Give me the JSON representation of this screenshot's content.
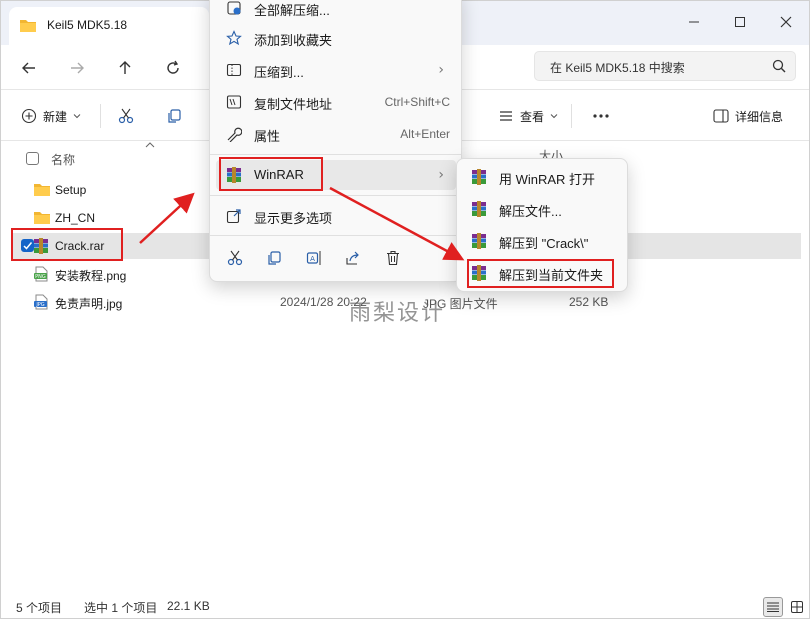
{
  "window": {
    "tab_title": "Keil5 MDK5.18",
    "search_placeholder": "在 Keil5 MDK5.18 中搜索"
  },
  "toolbar": {
    "new_label": "新建",
    "view_label": "查看",
    "details_label": "详细信息"
  },
  "columns": {
    "name": "名称",
    "size": "大小"
  },
  "files": [
    {
      "name": "Setup",
      "type": "folder"
    },
    {
      "name": "ZH_CN",
      "type": "folder"
    },
    {
      "name": "Crack.rar",
      "type": "rar",
      "selected": true
    },
    {
      "name": "安装教程.png",
      "type": "png"
    },
    {
      "name": "免责声明.jpg",
      "type": "jpg",
      "date": "2024/1/28 20:22",
      "kind": "JPG 图片文件",
      "size": "252 KB"
    }
  ],
  "context_menu": {
    "items": [
      {
        "label": "全部解压缩..."
      },
      {
        "label": "添加到收藏夹"
      },
      {
        "label": "压缩到..."
      },
      {
        "label": "复制文件地址",
        "shortcut": "Ctrl+Shift+C"
      },
      {
        "label": "属性",
        "shortcut": "Alt+Enter"
      },
      {
        "label": "WinRAR"
      },
      {
        "label": "显示更多选项"
      }
    ]
  },
  "submenu": {
    "items": [
      {
        "label": "用 WinRAR 打开"
      },
      {
        "label": "解压文件..."
      },
      {
        "label": "解压到 \"Crack\\\""
      },
      {
        "label": "解压到当前文件夹"
      }
    ]
  },
  "status": {
    "count": "5 个项目",
    "selected": "选中 1 个项目",
    "size": "22.1 KB"
  },
  "watermark": "雨梨设计",
  "colors": {
    "accent": "#1464c8",
    "annotation": "#e02020",
    "folder": "#f2b632"
  }
}
